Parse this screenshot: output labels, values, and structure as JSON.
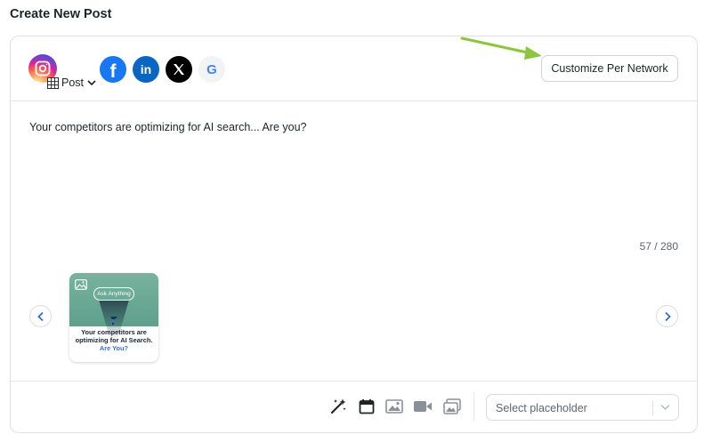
{
  "page": {
    "title": "Create New Post"
  },
  "networks": {
    "post_type_label": "Post",
    "items": [
      {
        "name": "instagram",
        "icon": "instagram-icon"
      },
      {
        "name": "facebook",
        "icon": "facebook-icon",
        "glyph": "f"
      },
      {
        "name": "linkedin",
        "icon": "linkedin-icon",
        "glyph": "in"
      },
      {
        "name": "x",
        "icon": "x-icon"
      },
      {
        "name": "google",
        "icon": "google-icon",
        "glyph": "G"
      }
    ],
    "customize_label": "Customize Per Network"
  },
  "composer": {
    "text": "Your competitors are optimizing for AI search... Are you?",
    "char_count": "57 / 280"
  },
  "media": {
    "thumbnail": {
      "pill_text": "Ask Anything",
      "headline_main": "Your competitors are optimizing for AI Search.",
      "headline_accent": "Are You?"
    }
  },
  "toolbar": {
    "tools": [
      "ai-magic-icon",
      "calendar-icon",
      "image-icon",
      "video-icon",
      "gallery-icon"
    ],
    "placeholder_select": "Select placeholder"
  },
  "colors": {
    "facebook": "#1877f2",
    "linkedin": "#0a66c2",
    "arrow": "#8cc63f",
    "accent_blue": "#3a6fd8"
  }
}
